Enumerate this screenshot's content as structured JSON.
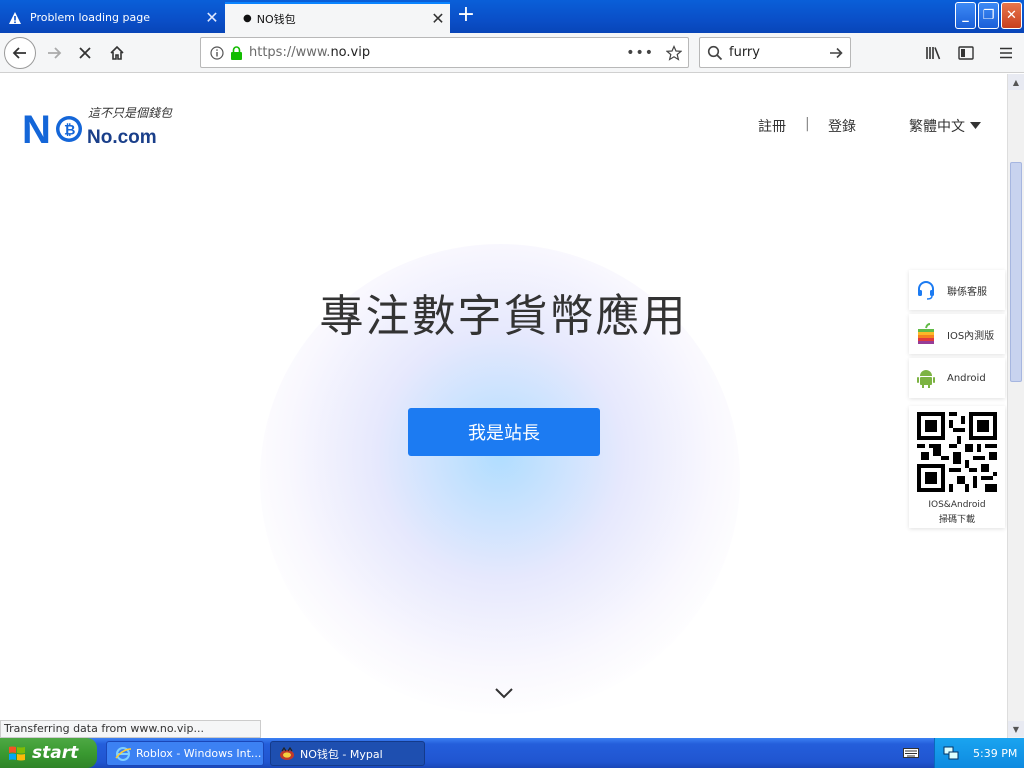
{
  "browser": {
    "tabs": [
      {
        "label": "Problem loading page",
        "active": false,
        "icon": "warning-icon"
      },
      {
        "label": "NO钱包",
        "active": true,
        "icon": "dot-icon"
      }
    ],
    "url": {
      "prefix": "https://www.",
      "domain": "no.vip"
    },
    "search": {
      "value": "furry"
    },
    "status_text": "Transferring data from www.no.vip..."
  },
  "site": {
    "logo": {
      "tagline": "這不只是個錢包",
      "name": "No.com"
    },
    "nav": {
      "register": "註冊",
      "separator": "|",
      "login": "登錄",
      "language": "繁體中文"
    },
    "hero": {
      "title": "專注數字貨幣應用",
      "cta": "我是站長"
    },
    "side": {
      "support": "聯係客服",
      "ios": "IOS內測版",
      "android": "Android",
      "qr_line1": "IOS&Android",
      "qr_line2": "掃碼下載"
    }
  },
  "taskbar": {
    "start": "start",
    "tasks": [
      {
        "label": "Roblox - Windows Int..."
      },
      {
        "label": "NO钱包 - Mypal"
      }
    ],
    "clock": "5:39 PM"
  },
  "colors": {
    "accent": "#1c7bf2",
    "titlebar": "#0a4fc8",
    "taskbar": "#245edb",
    "start": "#3a9a31"
  }
}
